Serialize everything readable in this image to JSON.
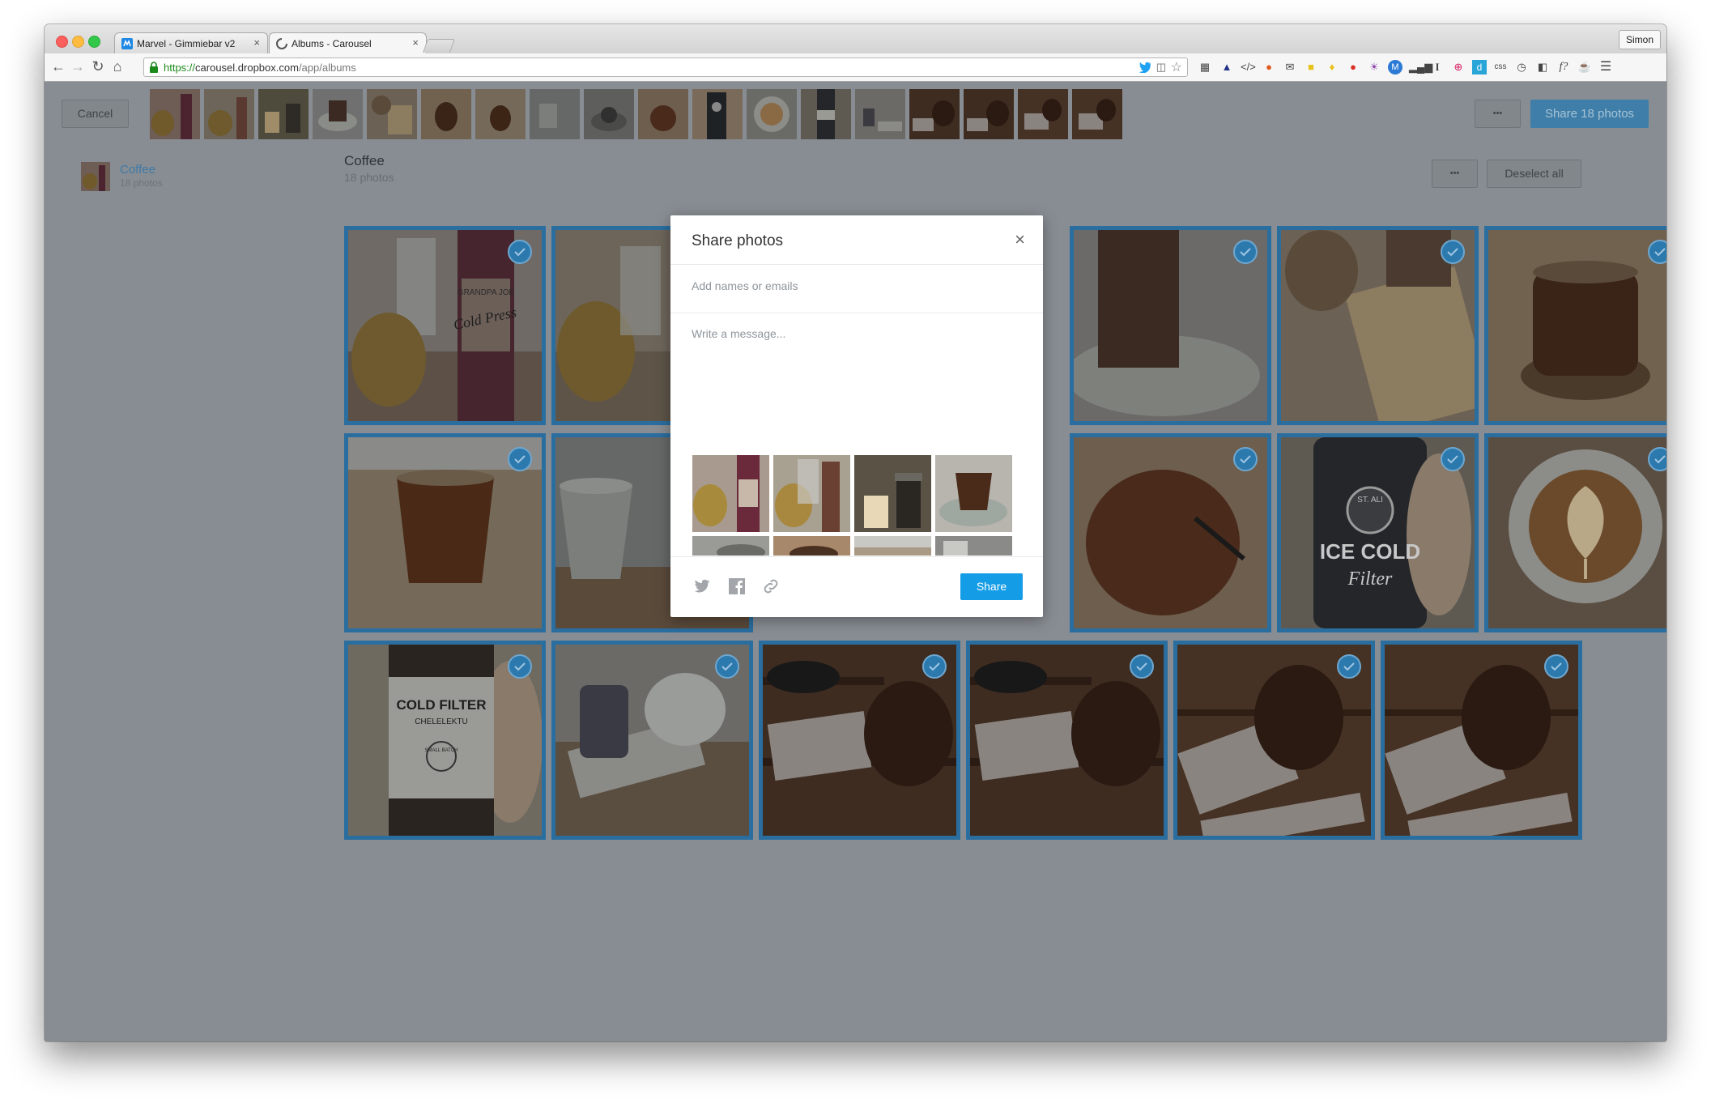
{
  "browser": {
    "tabs": [
      {
        "title": "Marvel - Gimmiebar v2",
        "close": "×"
      },
      {
        "title": "Albums - Carousel",
        "close": "×"
      }
    ],
    "profile": "Simon",
    "url_scheme": "https://",
    "url_host": "carousel.dropbox.com",
    "url_path": "/app/albums",
    "extension_labels": [
      "css",
      "I",
      "d",
      "M",
      "f?"
    ]
  },
  "header": {
    "cancel_label": "Cancel",
    "more_label": "•••",
    "share_label": "Share 18 photos"
  },
  "sidebar": {
    "album_name": "Coffee",
    "album_count": "18 photos"
  },
  "main": {
    "title": "Coffee",
    "count": "18 photos",
    "more_label": "•••",
    "deselect_label": "Deselect all"
  },
  "modal": {
    "title": "Share photos",
    "close": "×",
    "names_placeholder": "Add names or emails",
    "message_placeholder": "Write a message...",
    "share_label": "Share"
  },
  "photo_texts": {
    "bottle1_text": "Cold Press",
    "bottle1_brand": "GRANDPA JOE",
    "can_brand": "ST. ALI",
    "can_text1": "ICE COLD",
    "can_text2": "Filter",
    "filter_text1": "COLD FILTER",
    "filter_text2": "CHELELEKTU",
    "filter_text3": "SMALL BATCH"
  },
  "colors": {
    "accent": "#149ce6",
    "selection_border": "#2a6ea0",
    "overlay": "#888d93"
  }
}
